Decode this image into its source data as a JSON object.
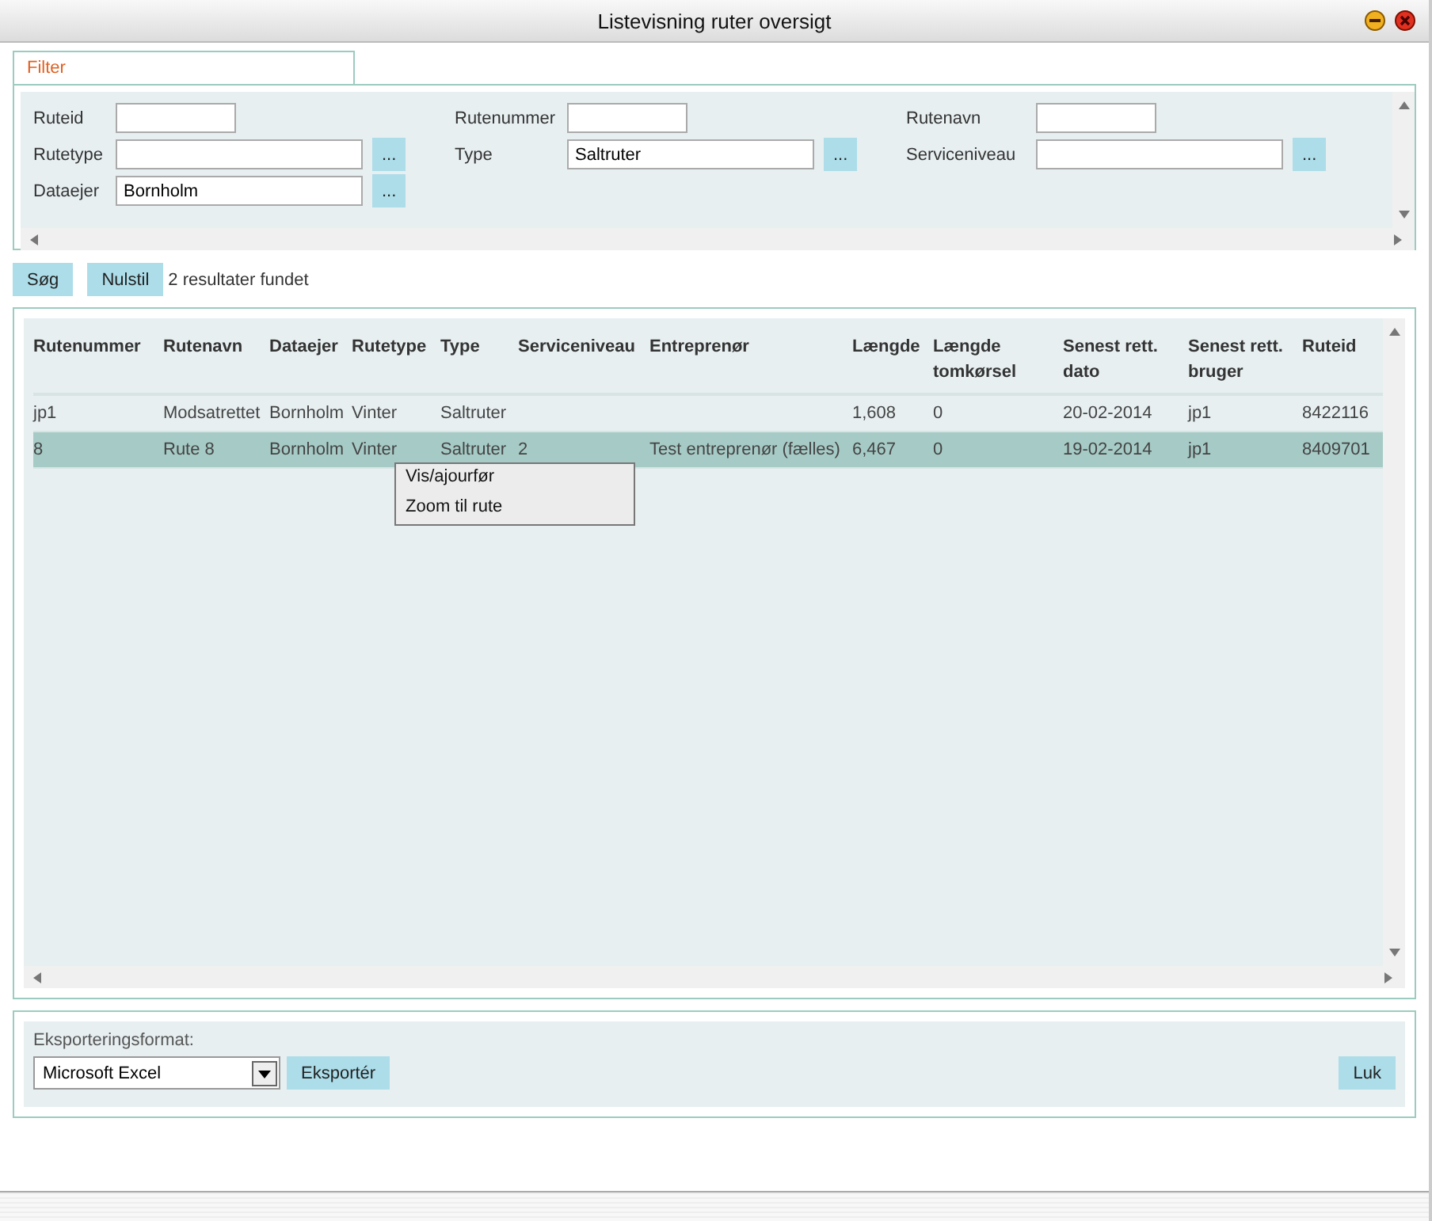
{
  "window": {
    "title": "Listevisning ruter oversigt"
  },
  "tabs": [
    {
      "label": "Filter",
      "selected": true
    }
  ],
  "filter_fields": [
    {
      "label": "Ruteid",
      "kind": "text"
    },
    {
      "label": "Rutenummer",
      "kind": "text"
    },
    {
      "label": "Rutenavn",
      "kind": "text"
    },
    {
      "label": "Rutetype",
      "kind": "lookup",
      "button": "..."
    },
    {
      "label": "Type",
      "value": "Saltruter",
      "kind": "lookup",
      "button": "..."
    },
    {
      "label": "Serviceniveau",
      "kind": "lookup",
      "button": "..."
    },
    {
      "label": "Dataejer",
      "value": "Bornholm",
      "kind": "lookup",
      "button": "..."
    }
  ],
  "actions": {
    "search": "Søg",
    "reset": "Nulstil",
    "result_count": "2 resultater fundet"
  },
  "table": {
    "columns": [
      "Rutenummer",
      "Rutenavn",
      "Dataejer",
      "Rutetype",
      "Type",
      "Serviceniveau",
      "Entreprenør",
      "Længde",
      "Længde tomkørsel",
      "Senest rett. dato",
      "Senest rett. bruger",
      "Ruteid"
    ],
    "rows": [
      {
        "selected": false,
        "cells": [
          "jp1",
          "Modsatrettet",
          "Bornholm",
          "Vinter",
          "Saltruter",
          "",
          "",
          "1,608",
          "0",
          "20-02-2014",
          "jp1",
          "8422116"
        ]
      },
      {
        "selected": true,
        "cells": [
          "8",
          "Rute 8",
          "Bornholm",
          "Vinter",
          "Saltruter",
          "2",
          "Test entreprenør (fælles)",
          "6,467",
          "0",
          "19-02-2014",
          "jp1",
          "8409701"
        ]
      }
    ]
  },
  "context_menu": {
    "items": [
      "Vis/ajourfør",
      "Zoom til rute"
    ]
  },
  "export": {
    "label": "Eksporteringsformat:",
    "format": "Microsoft Excel",
    "export_button": "Eksportér",
    "close_button": "Luk"
  }
}
